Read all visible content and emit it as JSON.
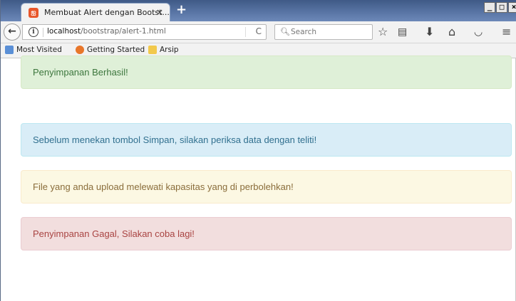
{
  "window": {
    "controls": [
      "_",
      "□",
      "×"
    ]
  },
  "tab": {
    "title": "Membuat Alert dengan Bootst...",
    "close": "×",
    "new_tab": "+"
  },
  "navbar": {
    "url_host": "localhost",
    "url_path": "/bootstrap/alert-1.html",
    "search_placeholder": "Search",
    "reload": "C"
  },
  "bookmarks": [
    {
      "label": "Most Visited",
      "icon": "most-visited-icon",
      "color": "#5a8fd6"
    },
    {
      "label": "Getting Started",
      "icon": "firefox-icon",
      "color": "#e8762a"
    },
    {
      "label": "Arsip",
      "icon": "folder-icon",
      "color": "#f2c94c"
    }
  ],
  "alerts": [
    {
      "type": "success",
      "text": "Penyimpanan Berhasil!"
    },
    {
      "type": "info",
      "text": "Sebelum menekan tombol Simpan, silakan periksa data dengan teliti!"
    },
    {
      "type": "warning",
      "text": "File yang anda upload melewati kapasitas yang di perbolehkan!"
    },
    {
      "type": "danger",
      "text": "Penyimpanan Gagal, Silakan coba lagi!"
    }
  ]
}
